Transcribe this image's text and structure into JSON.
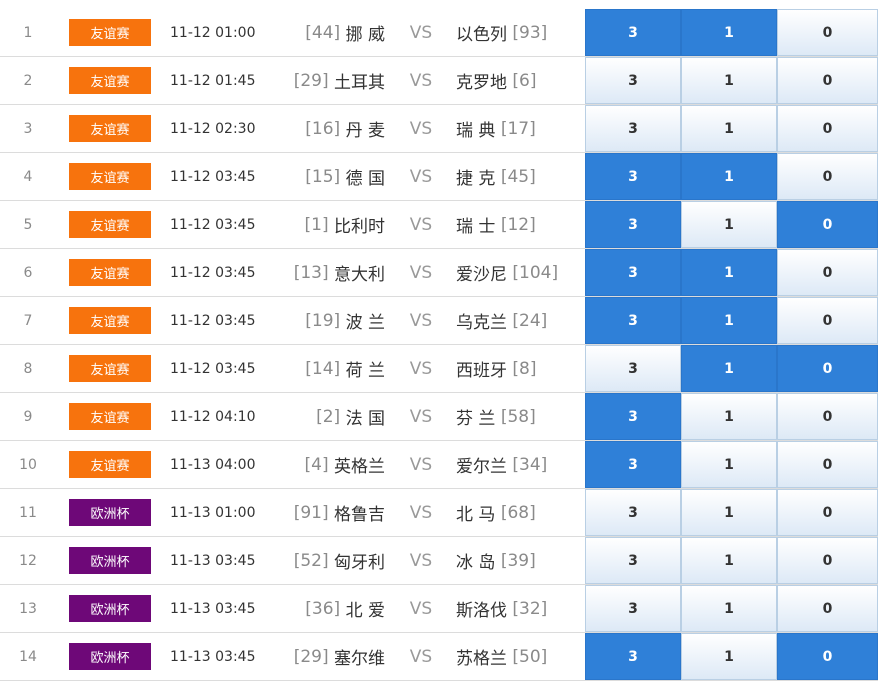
{
  "colors": {
    "friendly": "#f7730d",
    "euro": "#6e0878",
    "selected": "#2f80d8"
  },
  "vs_label": "VS",
  "option_labels": [
    "3",
    "1",
    "0"
  ],
  "matches": [
    {
      "no": "1",
      "league": "友谊赛",
      "league_type": "friendly",
      "time": "11-12 01:00",
      "home_rank": "[44]",
      "home": "挪 威",
      "away": "以色列",
      "away_rank": "[93]",
      "selected": [
        true,
        true,
        false
      ]
    },
    {
      "no": "2",
      "league": "友谊赛",
      "league_type": "friendly",
      "time": "11-12 01:45",
      "home_rank": "[29]",
      "home": "土耳其",
      "away": "克罗地",
      "away_rank": "[6]",
      "selected": [
        false,
        false,
        false
      ]
    },
    {
      "no": "3",
      "league": "友谊赛",
      "league_type": "friendly",
      "time": "11-12 02:30",
      "home_rank": "[16]",
      "home": "丹 麦",
      "away": "瑞 典",
      "away_rank": "[17]",
      "selected": [
        false,
        false,
        false
      ]
    },
    {
      "no": "4",
      "league": "友谊赛",
      "league_type": "friendly",
      "time": "11-12 03:45",
      "home_rank": "[15]",
      "home": "德 国",
      "away": "捷 克",
      "away_rank": "[45]",
      "selected": [
        true,
        true,
        false
      ]
    },
    {
      "no": "5",
      "league": "友谊赛",
      "league_type": "friendly",
      "time": "11-12 03:45",
      "home_rank": "[1]",
      "home": "比利时",
      "away": "瑞 士",
      "away_rank": "[12]",
      "selected": [
        true,
        false,
        true
      ]
    },
    {
      "no": "6",
      "league": "友谊赛",
      "league_type": "friendly",
      "time": "11-12 03:45",
      "home_rank": "[13]",
      "home": "意大利",
      "away": "爱沙尼",
      "away_rank": "[104]",
      "selected": [
        true,
        true,
        false
      ]
    },
    {
      "no": "7",
      "league": "友谊赛",
      "league_type": "friendly",
      "time": "11-12 03:45",
      "home_rank": "[19]",
      "home": "波 兰",
      "away": "乌克兰",
      "away_rank": "[24]",
      "selected": [
        true,
        true,
        false
      ]
    },
    {
      "no": "8",
      "league": "友谊赛",
      "league_type": "friendly",
      "time": "11-12 03:45",
      "home_rank": "[14]",
      "home": "荷 兰",
      "away": "西班牙",
      "away_rank": "[8]",
      "selected": [
        false,
        true,
        true
      ]
    },
    {
      "no": "9",
      "league": "友谊赛",
      "league_type": "friendly",
      "time": "11-12 04:10",
      "home_rank": "[2]",
      "home": "法 国",
      "away": "芬 兰",
      "away_rank": "[58]",
      "selected": [
        true,
        false,
        false
      ]
    },
    {
      "no": "10",
      "league": "友谊赛",
      "league_type": "friendly",
      "time": "11-13 04:00",
      "home_rank": "[4]",
      "home": "英格兰",
      "away": "爱尔兰",
      "away_rank": "[34]",
      "selected": [
        true,
        false,
        false
      ]
    },
    {
      "no": "11",
      "league": "欧洲杯",
      "league_type": "euro",
      "time": "11-13 01:00",
      "home_rank": "[91]",
      "home": "格鲁吉",
      "away": "北 马",
      "away_rank": "[68]",
      "selected": [
        false,
        false,
        false
      ]
    },
    {
      "no": "12",
      "league": "欧洲杯",
      "league_type": "euro",
      "time": "11-13 03:45",
      "home_rank": "[52]",
      "home": "匈牙利",
      "away": "冰 岛",
      "away_rank": "[39]",
      "selected": [
        false,
        false,
        false
      ]
    },
    {
      "no": "13",
      "league": "欧洲杯",
      "league_type": "euro",
      "time": "11-13 03:45",
      "home_rank": "[36]",
      "home": "北 爱",
      "away": "斯洛伐",
      "away_rank": "[32]",
      "selected": [
        false,
        false,
        false
      ]
    },
    {
      "no": "14",
      "league": "欧洲杯",
      "league_type": "euro",
      "time": "11-13 03:45",
      "home_rank": "[29]",
      "home": "塞尔维",
      "away": "苏格兰",
      "away_rank": "[50]",
      "selected": [
        true,
        false,
        true
      ]
    }
  ]
}
